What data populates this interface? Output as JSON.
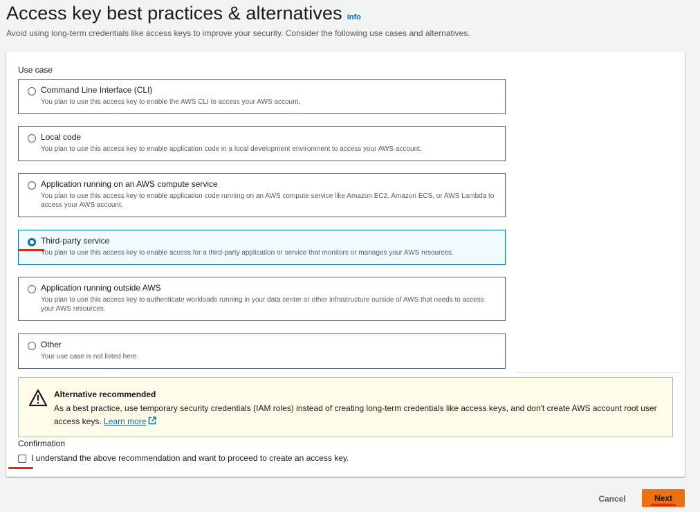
{
  "header": {
    "title": "Access key best practices & alternatives",
    "info_label": "Info",
    "subtitle": "Avoid using long-term credentials like access keys to improve your security. Consider the following use cases and alternatives."
  },
  "use_case": {
    "label": "Use case",
    "selected": "Third-party service",
    "options": [
      {
        "title": "Command Line Interface (CLI)",
        "description": "You plan to use this access key to enable the AWS CLI to access your AWS account."
      },
      {
        "title": "Local code",
        "description": "You plan to use this access key to enable application code in a local development environment to access your AWS account."
      },
      {
        "title": "Application running on an AWS compute service",
        "description": "You plan to use this access key to enable application code running on an AWS compute service like Amazon EC2, Amazon ECS, or AWS Lambda to access your AWS account."
      },
      {
        "title": "Third-party service",
        "description": "You plan to use this access key to enable access for a third-party application or service that monitors or manages your AWS resources."
      },
      {
        "title": "Application running outside AWS",
        "description": "You plan to use this access key to authenticate workloads running in your data center or other infrastructure outside of AWS that needs to access your AWS resources."
      },
      {
        "title": "Other",
        "description": "Your use case is not listed here."
      }
    ]
  },
  "alert": {
    "title": "Alternative recommended",
    "text": "As a best practice, use temporary security credentials (IAM roles) instead of creating long-term credentials like access keys, and don't create AWS account root user access keys.",
    "link_label": "Learn more"
  },
  "confirmation": {
    "label": "Confirmation",
    "checkbox_label": "I understand the above recommendation and want to proceed to create an access key.",
    "checked": false
  },
  "footer": {
    "cancel_label": "Cancel",
    "next_label": "Next"
  },
  "colors": {
    "accent": "#0073bb",
    "primary_button": "#ec7211",
    "annotation_red": "#d13212",
    "warning_bg": "#fffce9"
  }
}
